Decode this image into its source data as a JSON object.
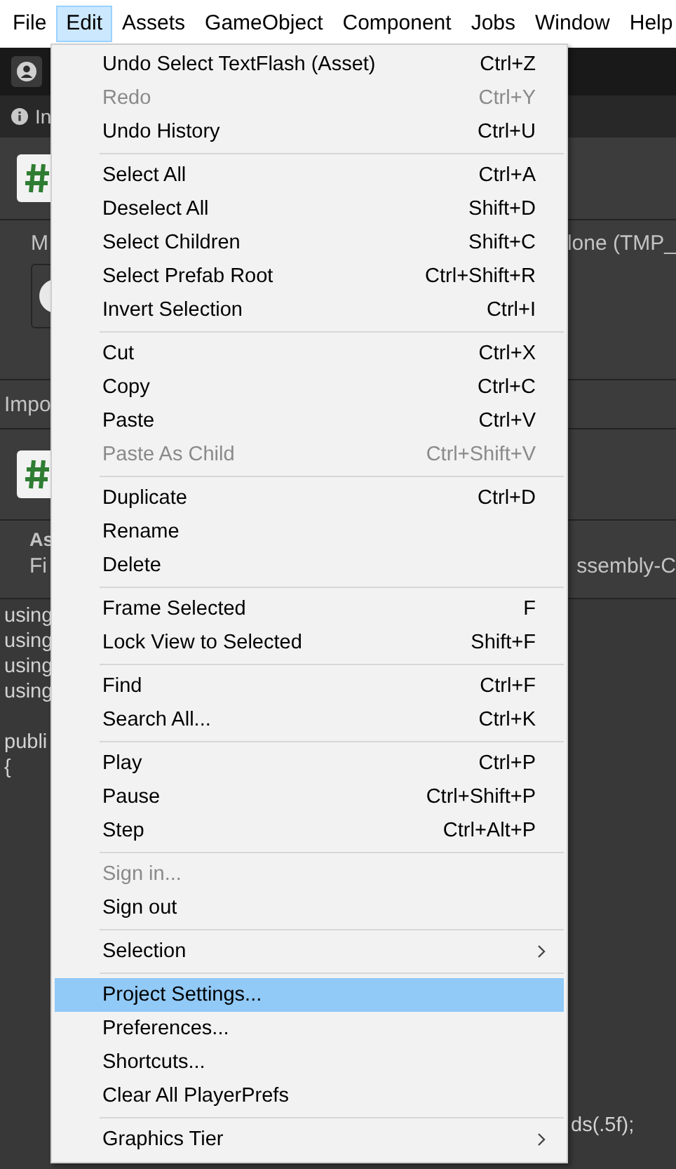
{
  "menubar": [
    {
      "label": "File",
      "selected": false
    },
    {
      "label": "Edit",
      "selected": true
    },
    {
      "label": "Assets",
      "selected": false
    },
    {
      "label": "GameObject",
      "selected": false
    },
    {
      "label": "Component",
      "selected": false
    },
    {
      "label": "Jobs",
      "selected": false
    },
    {
      "label": "Window",
      "selected": false
    },
    {
      "label": "Help",
      "selected": false
    }
  ],
  "inspector": {
    "tab_label": "In",
    "field_label": "M",
    "field_value": "lone (TMP_",
    "section_label": "Impo",
    "asset_heading": "As",
    "asset_label": "Fi",
    "asset_value": "ssembly-C"
  },
  "code": {
    "blocks": [
      [
        "using",
        "using",
        "using",
        "using"
      ],
      [
        "publi",
        "{"
      ]
    ],
    "fragment": "ds(.5f);"
  },
  "menu": {
    "groups": [
      [
        {
          "label": "Undo Select TextFlash (Asset)",
          "shortcut": "Ctrl+Z",
          "disabled": false,
          "selected": false
        },
        {
          "label": "Redo",
          "shortcut": "Ctrl+Y",
          "disabled": true,
          "selected": false
        },
        {
          "label": "Undo History",
          "shortcut": "Ctrl+U",
          "disabled": false,
          "selected": false
        }
      ],
      [
        {
          "label": "Select All",
          "shortcut": "Ctrl+A",
          "disabled": false,
          "selected": false
        },
        {
          "label": "Deselect All",
          "shortcut": "Shift+D",
          "disabled": false,
          "selected": false
        },
        {
          "label": "Select Children",
          "shortcut": "Shift+C",
          "disabled": false,
          "selected": false
        },
        {
          "label": "Select Prefab Root",
          "shortcut": "Ctrl+Shift+R",
          "disabled": false,
          "selected": false
        },
        {
          "label": "Invert Selection",
          "shortcut": "Ctrl+I",
          "disabled": false,
          "selected": false
        }
      ],
      [
        {
          "label": "Cut",
          "shortcut": "Ctrl+X",
          "disabled": false,
          "selected": false
        },
        {
          "label": "Copy",
          "shortcut": "Ctrl+C",
          "disabled": false,
          "selected": false
        },
        {
          "label": "Paste",
          "shortcut": "Ctrl+V",
          "disabled": false,
          "selected": false
        },
        {
          "label": "Paste As Child",
          "shortcut": "Ctrl+Shift+V",
          "disabled": true,
          "selected": false
        }
      ],
      [
        {
          "label": "Duplicate",
          "shortcut": "Ctrl+D",
          "disabled": false,
          "selected": false
        },
        {
          "label": "Rename",
          "disabled": false,
          "selected": false
        },
        {
          "label": "Delete",
          "disabled": false,
          "selected": false
        }
      ],
      [
        {
          "label": "Frame Selected",
          "shortcut": "F",
          "disabled": false,
          "selected": false
        },
        {
          "label": "Lock View to Selected",
          "shortcut": "Shift+F",
          "disabled": false,
          "selected": false
        }
      ],
      [
        {
          "label": "Find",
          "shortcut": "Ctrl+F",
          "disabled": false,
          "selected": false
        },
        {
          "label": "Search All...",
          "shortcut": "Ctrl+K",
          "disabled": false,
          "selected": false
        }
      ],
      [
        {
          "label": "Play",
          "shortcut": "Ctrl+P",
          "disabled": false,
          "selected": false
        },
        {
          "label": "Pause",
          "shortcut": "Ctrl+Shift+P",
          "disabled": false,
          "selected": false
        },
        {
          "label": "Step",
          "shortcut": "Ctrl+Alt+P",
          "disabled": false,
          "selected": false
        }
      ],
      [
        {
          "label": "Sign in...",
          "disabled": true,
          "selected": false
        },
        {
          "label": "Sign out",
          "disabled": false,
          "selected": false
        }
      ],
      [
        {
          "label": "Selection",
          "submenu": true,
          "disabled": false,
          "selected": false
        }
      ],
      [
        {
          "label": "Project Settings...",
          "disabled": false,
          "selected": true
        },
        {
          "label": "Preferences...",
          "disabled": false,
          "selected": false
        },
        {
          "label": "Shortcuts...",
          "disabled": false,
          "selected": false
        },
        {
          "label": "Clear All PlayerPrefs",
          "disabled": false,
          "selected": false
        }
      ],
      [
        {
          "label": "Graphics Tier",
          "submenu": true,
          "disabled": false,
          "selected": false
        }
      ]
    ]
  }
}
